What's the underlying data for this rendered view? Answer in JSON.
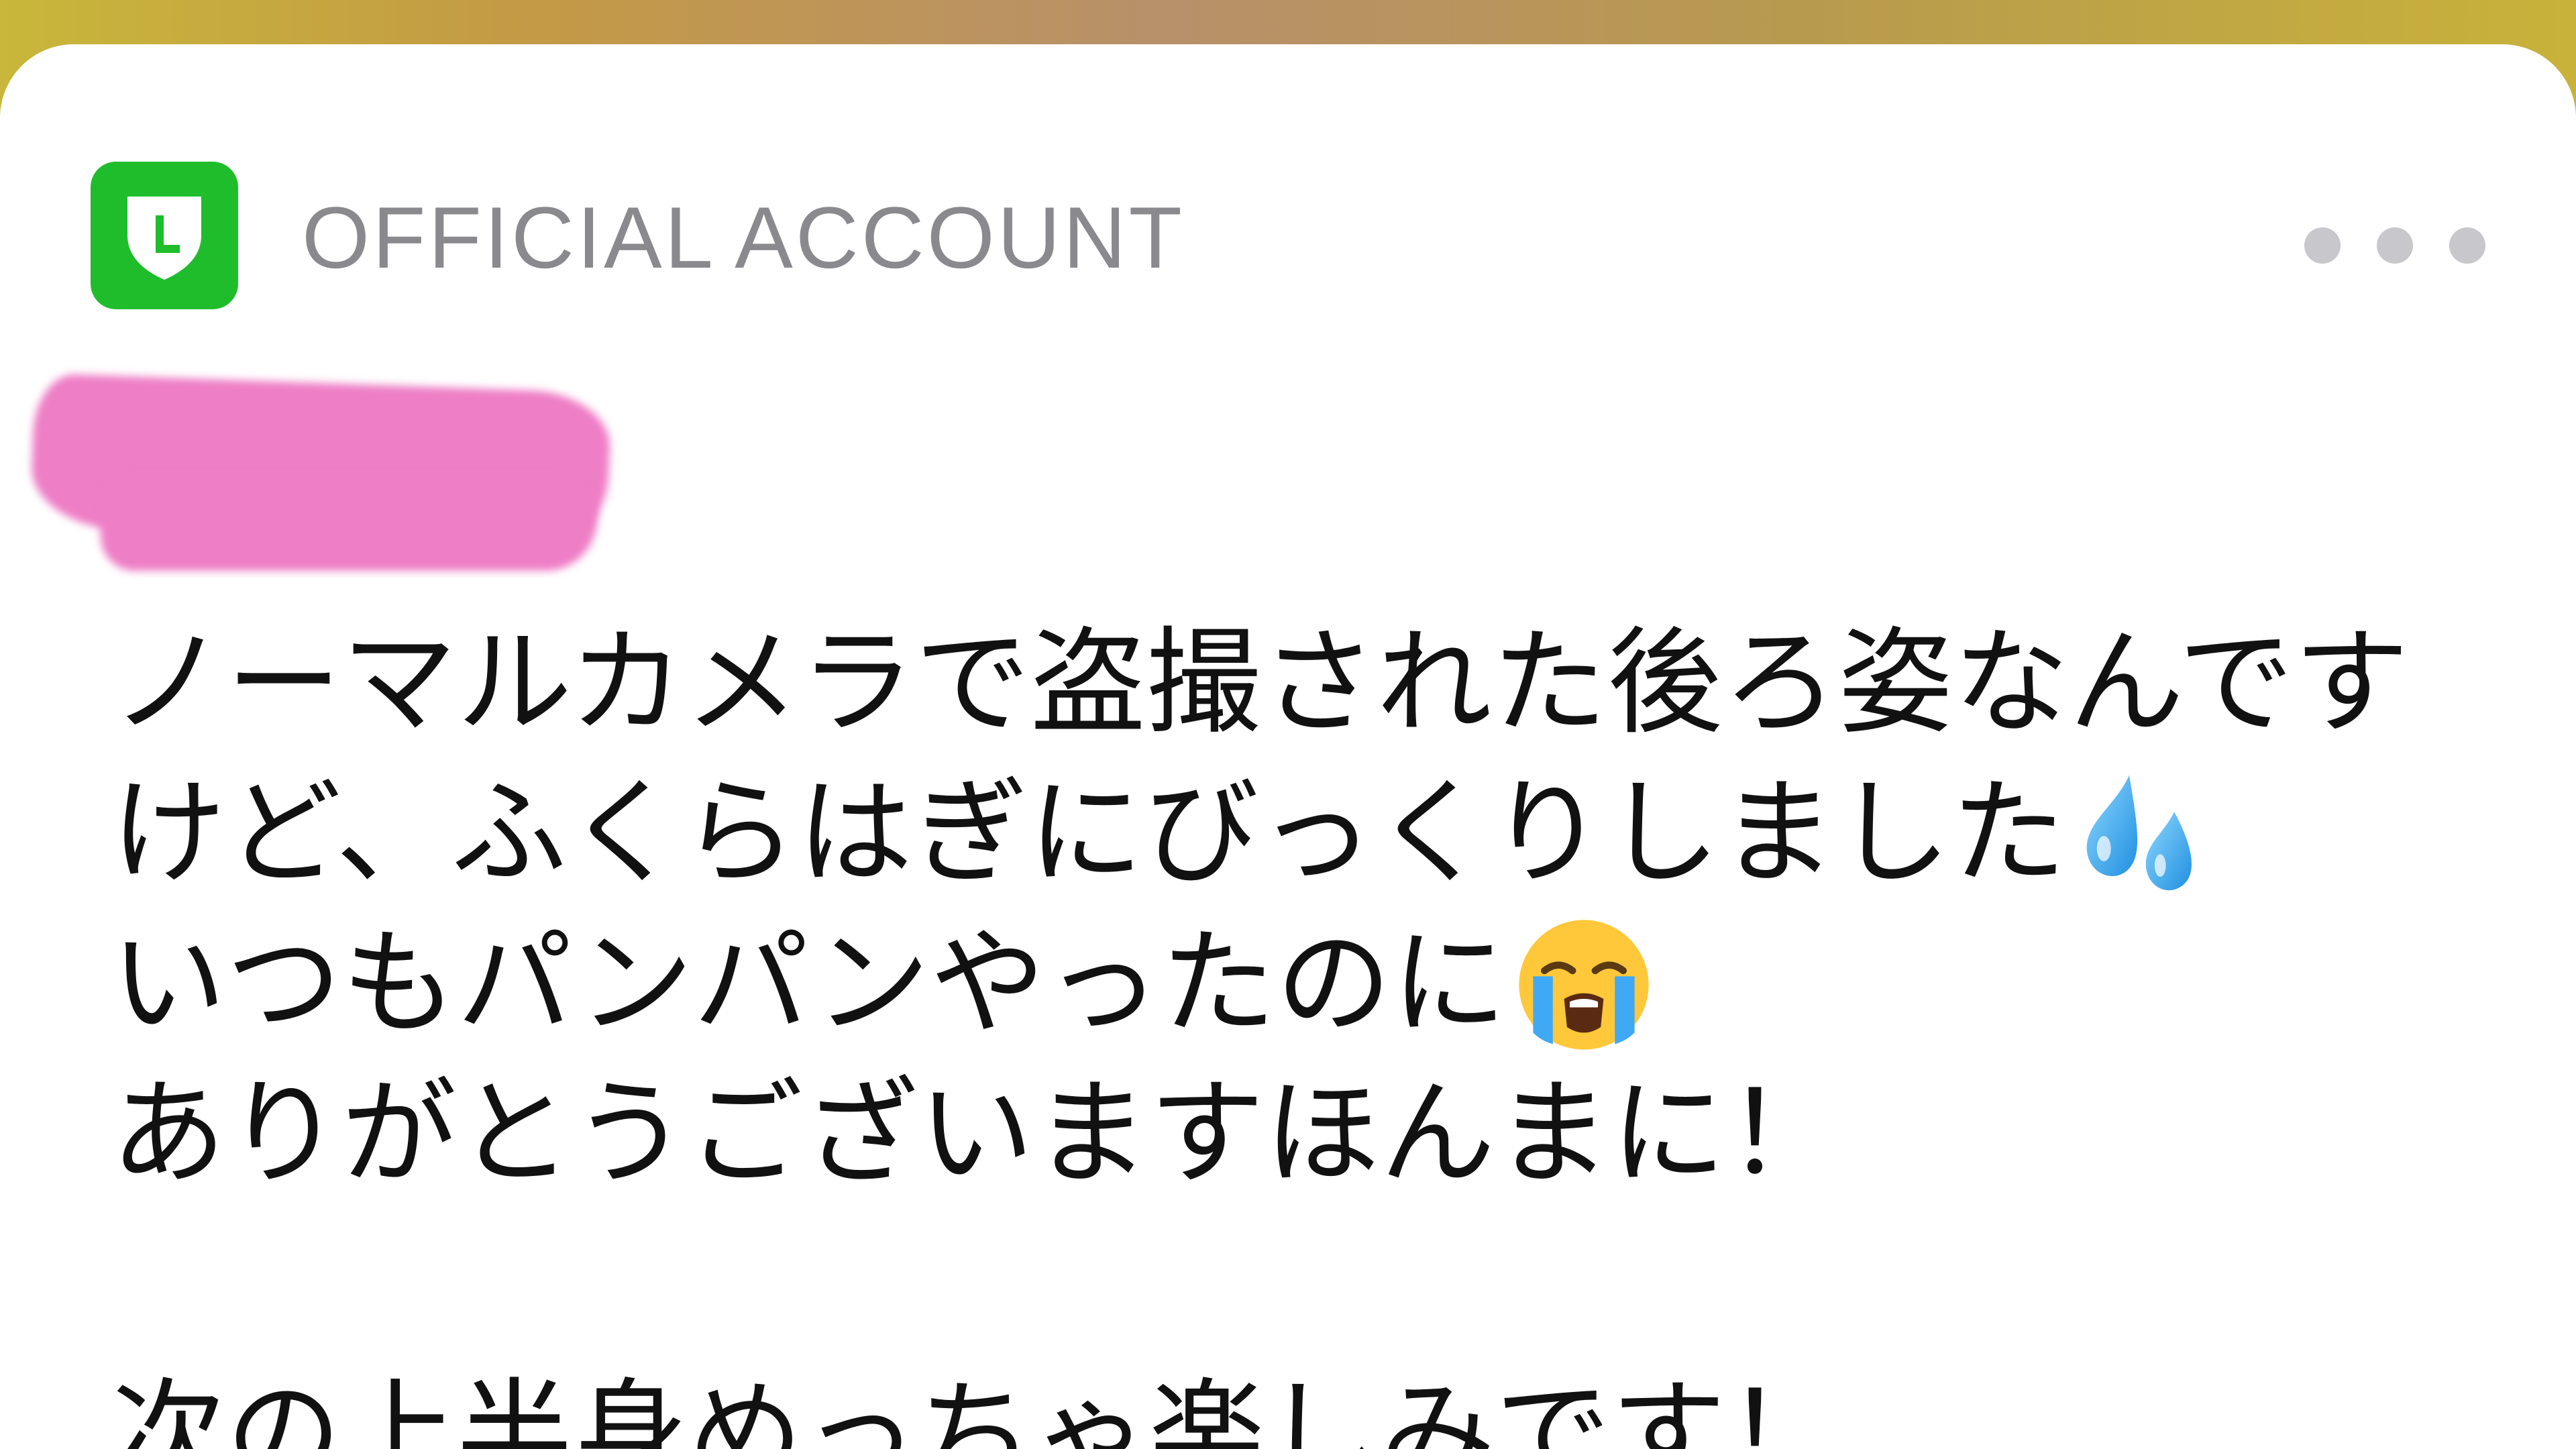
{
  "notification": {
    "app_label": "OFFICIAL ACCOUNT",
    "app_icon": "line-official-account-icon",
    "more_icon": "more-dots-icon",
    "colors": {
      "app_icon_bg": "#1fbd2c",
      "label_gray": "#8a8a8e",
      "redaction_pink": "#ee7ec6"
    }
  },
  "message": {
    "lines": [
      "ノーマルカメラで盗撮された後ろ姿なんです",
      "けど、ふくらはぎにびっくりしました",
      "いつもパンパンやったのに",
      "ありがとうございますほんまに！",
      "次の上半身めっちゃ楽しみです！"
    ],
    "emojis": [
      "sweat-droplets-emoji",
      "loudly-crying-face-emoji"
    ]
  }
}
